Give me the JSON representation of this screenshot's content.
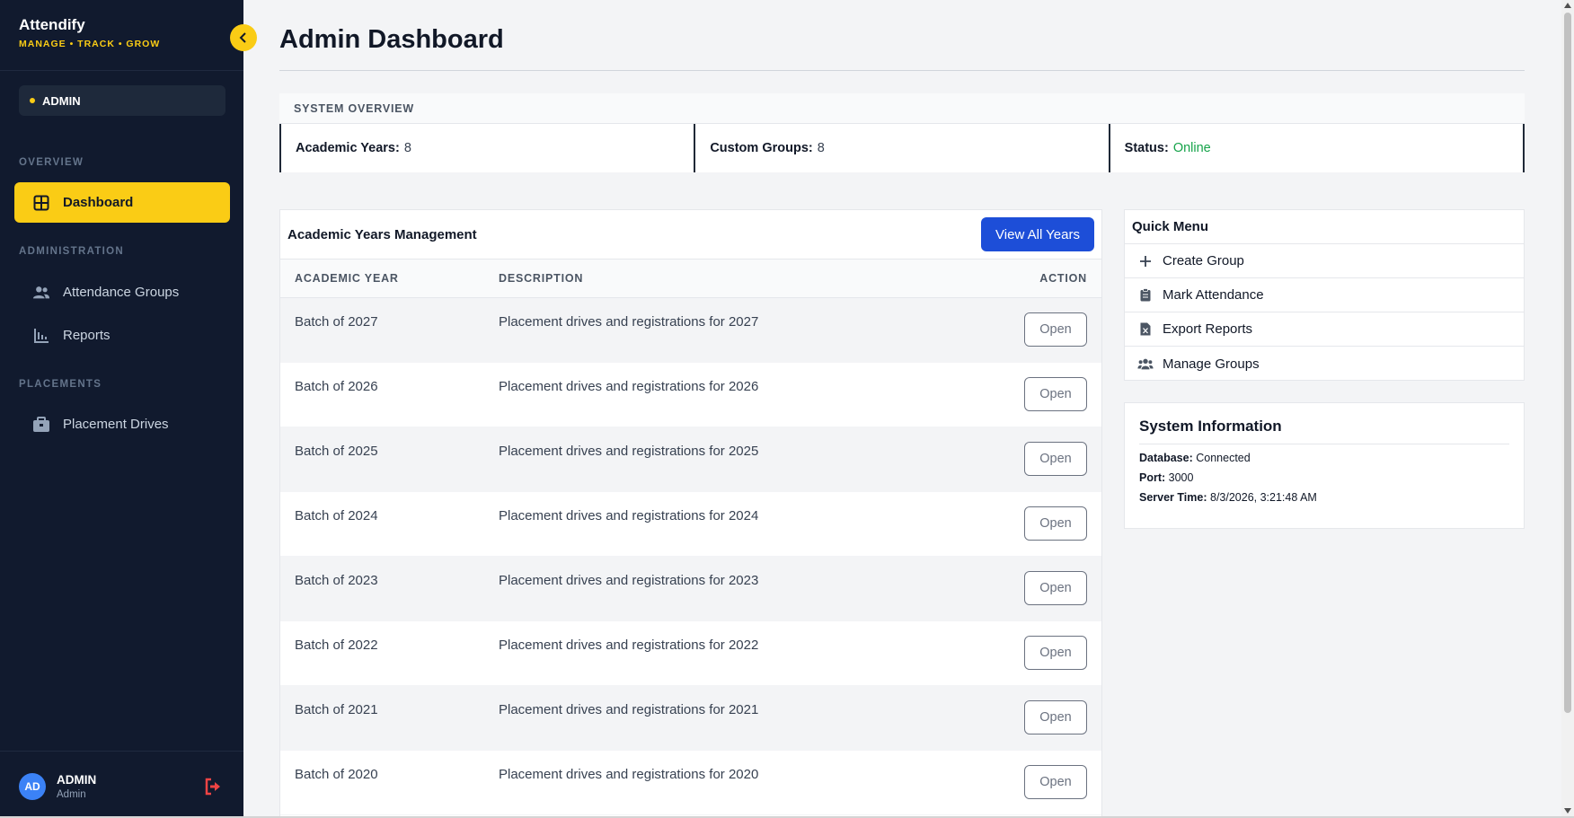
{
  "app": {
    "name": "Attendify",
    "tagline": "MANAGE • TRACK • GROW",
    "role_badge": "ADMIN"
  },
  "sidebar": {
    "sections": {
      "overview": "OVERVIEW",
      "administration": "ADMINISTRATION",
      "placements": "PLACEMENTS"
    },
    "items": [
      {
        "label": "Dashboard",
        "icon": "dashboard-icon",
        "active": true
      },
      {
        "label": "Attendance Groups",
        "icon": "users-icon",
        "active": false
      },
      {
        "label": "Reports",
        "icon": "chart-icon",
        "active": false
      },
      {
        "label": "Placement Drives",
        "icon": "briefcase-icon",
        "active": false
      }
    ],
    "user": {
      "initials": "AD",
      "name": "ADMIN",
      "role": "Admin"
    }
  },
  "page": {
    "title": "Admin Dashboard"
  },
  "overview": {
    "header": "SYSTEM OVERVIEW",
    "academic_years_label": "Academic Years:",
    "academic_years_value": "8",
    "custom_groups_label": "Custom Groups:",
    "custom_groups_value": "8",
    "status_label": "Status:",
    "status_value": "Online"
  },
  "years": {
    "title": "Academic Years Management",
    "view_all_label": "View All Years",
    "columns": [
      "ACADEMIC YEAR",
      "DESCRIPTION",
      "ACTION"
    ],
    "open_label": "Open",
    "rows": [
      {
        "year": "Batch of 2027",
        "desc": "Placement drives and registrations for 2027"
      },
      {
        "year": "Batch of 2026",
        "desc": "Placement drives and registrations for 2026"
      },
      {
        "year": "Batch of 2025",
        "desc": "Placement drives and registrations for 2025"
      },
      {
        "year": "Batch of 2024",
        "desc": "Placement drives and registrations for 2024"
      },
      {
        "year": "Batch of 2023",
        "desc": "Placement drives and registrations for 2023"
      },
      {
        "year": "Batch of 2022",
        "desc": "Placement drives and registrations for 2022"
      },
      {
        "year": "Batch of 2021",
        "desc": "Placement drives and registrations for 2021"
      },
      {
        "year": "Batch of 2020",
        "desc": "Placement drives and registrations for 2020"
      }
    ]
  },
  "quick_menu": {
    "title": "Quick Menu",
    "items": [
      {
        "label": "Create Group",
        "icon": "plus-icon"
      },
      {
        "label": "Mark Attendance",
        "icon": "clipboard-icon"
      },
      {
        "label": "Export Reports",
        "icon": "file-excel-icon"
      },
      {
        "label": "Manage Groups",
        "icon": "users-icon"
      }
    ]
  },
  "system_info": {
    "title": "System Information",
    "database_label": "Database:",
    "database_value": "Connected",
    "port_label": "Port:",
    "port_value": "3000",
    "server_time_label": "Server Time:",
    "server_time_value": "8/3/2026, 3:21:48 AM"
  },
  "colors": {
    "sidebar_bg": "#111a2e",
    "accent": "#facc15",
    "primary": "#1d4ed8",
    "online": "#16a34a",
    "logout": "#ef4444"
  }
}
